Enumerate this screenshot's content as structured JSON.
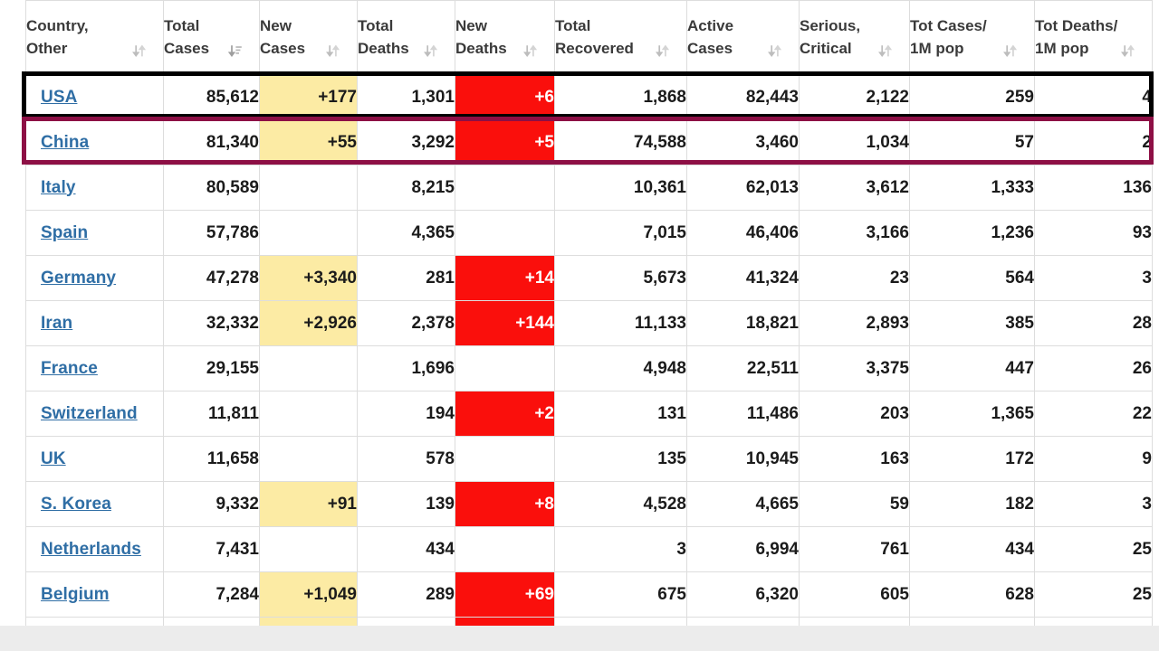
{
  "table": {
    "columns": [
      {
        "line1": "Country,",
        "line2": "Other",
        "sort_icon": "sort-neutral-icon",
        "key": "country"
      },
      {
        "line1": "Total",
        "line2": "Cases",
        "sort_icon": "sort-descending-icon",
        "key": "total_cases"
      },
      {
        "line1": "New",
        "line2": "Cases",
        "sort_icon": "sort-neutral-icon",
        "key": "new_cases"
      },
      {
        "line1": "Total",
        "line2": "Deaths",
        "sort_icon": "sort-neutral-icon",
        "key": "total_deaths"
      },
      {
        "line1": "New",
        "line2": "Deaths",
        "sort_icon": "sort-neutral-icon",
        "key": "new_deaths"
      },
      {
        "line1": "Total",
        "line2": "Recovered",
        "sort_icon": "sort-neutral-icon",
        "key": "total_recovered"
      },
      {
        "line1": "Active",
        "line2": "Cases",
        "sort_icon": "sort-neutral-icon",
        "key": "active_cases"
      },
      {
        "line1": "Serious,",
        "line2": "Critical",
        "sort_icon": "sort-neutral-icon",
        "key": "serious_critical"
      },
      {
        "line1": "Tot Cases/",
        "line2": "1M pop",
        "sort_icon": "sort-neutral-icon",
        "key": "tot_cases_1m"
      },
      {
        "line1": "Tot Deaths/",
        "line2": "1M pop",
        "sort_icon": "sort-neutral-icon",
        "key": "tot_deaths_1m"
      }
    ],
    "rows": [
      {
        "country": "USA",
        "total_cases": "85,612",
        "new_cases": "+177",
        "total_deaths": "1,301",
        "new_deaths": "+6",
        "total_recovered": "1,868",
        "active_cases": "82,443",
        "serious_critical": "2,122",
        "tot_cases_1m": "259",
        "tot_deaths_1m": "4",
        "highlight": "black"
      },
      {
        "country": "China",
        "total_cases": "81,340",
        "new_cases": "+55",
        "total_deaths": "3,292",
        "new_deaths": "+5",
        "total_recovered": "74,588",
        "active_cases": "3,460",
        "serious_critical": "1,034",
        "tot_cases_1m": "57",
        "tot_deaths_1m": "2",
        "highlight": "maroon"
      },
      {
        "country": "Italy",
        "total_cases": "80,589",
        "new_cases": "",
        "total_deaths": "8,215",
        "new_deaths": "",
        "total_recovered": "10,361",
        "active_cases": "62,013",
        "serious_critical": "3,612",
        "tot_cases_1m": "1,333",
        "tot_deaths_1m": "136",
        "highlight": ""
      },
      {
        "country": "Spain",
        "total_cases": "57,786",
        "new_cases": "",
        "total_deaths": "4,365",
        "new_deaths": "",
        "total_recovered": "7,015",
        "active_cases": "46,406",
        "serious_critical": "3,166",
        "tot_cases_1m": "1,236",
        "tot_deaths_1m": "93",
        "highlight": ""
      },
      {
        "country": "Germany",
        "total_cases": "47,278",
        "new_cases": "+3,340",
        "total_deaths": "281",
        "new_deaths": "+14",
        "total_recovered": "5,673",
        "active_cases": "41,324",
        "serious_critical": "23",
        "tot_cases_1m": "564",
        "tot_deaths_1m": "3",
        "highlight": ""
      },
      {
        "country": "Iran",
        "total_cases": "32,332",
        "new_cases": "+2,926",
        "total_deaths": "2,378",
        "new_deaths": "+144",
        "total_recovered": "11,133",
        "active_cases": "18,821",
        "serious_critical": "2,893",
        "tot_cases_1m": "385",
        "tot_deaths_1m": "28",
        "highlight": ""
      },
      {
        "country": "France",
        "total_cases": "29,155",
        "new_cases": "",
        "total_deaths": "1,696",
        "new_deaths": "",
        "total_recovered": "4,948",
        "active_cases": "22,511",
        "serious_critical": "3,375",
        "tot_cases_1m": "447",
        "tot_deaths_1m": "26",
        "highlight": ""
      },
      {
        "country": "Switzerland",
        "total_cases": "11,811",
        "new_cases": "",
        "total_deaths": "194",
        "new_deaths": "+2",
        "total_recovered": "131",
        "active_cases": "11,486",
        "serious_critical": "203",
        "tot_cases_1m": "1,365",
        "tot_deaths_1m": "22",
        "highlight": ""
      },
      {
        "country": "UK",
        "total_cases": "11,658",
        "new_cases": "",
        "total_deaths": "578",
        "new_deaths": "",
        "total_recovered": "135",
        "active_cases": "10,945",
        "serious_critical": "163",
        "tot_cases_1m": "172",
        "tot_deaths_1m": "9",
        "highlight": ""
      },
      {
        "country": "S. Korea",
        "total_cases": "9,332",
        "new_cases": "+91",
        "total_deaths": "139",
        "new_deaths": "+8",
        "total_recovered": "4,528",
        "active_cases": "4,665",
        "serious_critical": "59",
        "tot_cases_1m": "182",
        "tot_deaths_1m": "3",
        "highlight": ""
      },
      {
        "country": "Netherlands",
        "total_cases": "7,431",
        "new_cases": "",
        "total_deaths": "434",
        "new_deaths": "",
        "total_recovered": "3",
        "active_cases": "6,994",
        "serious_critical": "761",
        "tot_cases_1m": "434",
        "tot_deaths_1m": "25",
        "highlight": ""
      },
      {
        "country": "Belgium",
        "total_cases": "7,284",
        "new_cases": "+1,049",
        "total_deaths": "289",
        "new_deaths": "+69",
        "total_recovered": "675",
        "active_cases": "6,320",
        "serious_critical": "605",
        "tot_cases_1m": "628",
        "tot_deaths_1m": "25",
        "highlight": ""
      }
    ]
  },
  "colors": {
    "new_cases_highlight": "#fceba4",
    "new_deaths_highlight": "#fa0f0c",
    "link": "#2f6ea5",
    "usa_outline": "#000000",
    "china_outline": "#8d0f45",
    "grid": "#dddddd",
    "page_band": "#ececec"
  }
}
